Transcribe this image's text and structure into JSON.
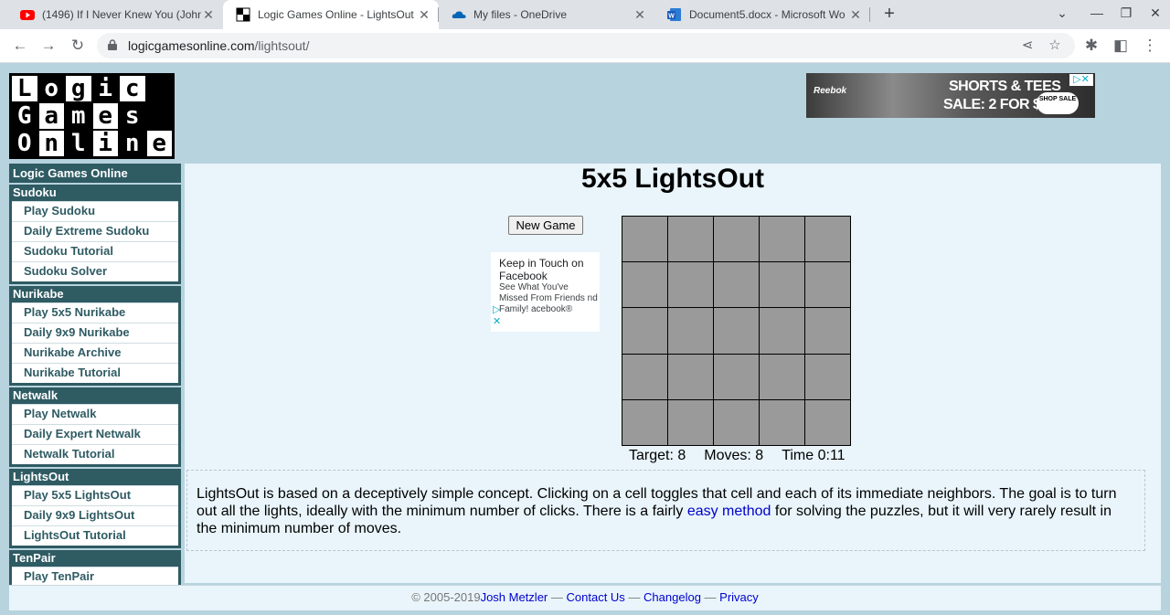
{
  "browser": {
    "tabs": [
      {
        "title": "(1496) If I Never Knew You (John",
        "favicon": "youtube-icon",
        "active": false
      },
      {
        "title": "Logic Games Online - LightsOut",
        "favicon": "logic-games-icon",
        "active": true
      },
      {
        "title": "My files - OneDrive",
        "favicon": "onedrive-icon",
        "active": false
      },
      {
        "title": "Document5.docx - Microsoft Wo",
        "favicon": "word-icon",
        "active": false
      }
    ],
    "url_host": "logicgamesonline.com",
    "url_path": "/lightsout/"
  },
  "logo": {
    "rows": [
      [
        "L",
        "o",
        "g",
        "i",
        "c",
        ""
      ],
      [
        "G",
        "a",
        "m",
        "e",
        "s",
        ""
      ],
      [
        "O",
        "n",
        "l",
        "i",
        "n",
        "e"
      ]
    ]
  },
  "ad_banner": {
    "brand": "Reebok",
    "line1": "SHORTS & TEES",
    "line2": "SALE: 2 FOR $50",
    "cta": "SHOP SALE"
  },
  "sidebar": {
    "home": "Logic Games Online",
    "groups": [
      {
        "title": "Sudoku",
        "items": [
          "Play Sudoku",
          "Daily Extreme Sudoku",
          "Sudoku Tutorial",
          "Sudoku Solver"
        ]
      },
      {
        "title": "Nurikabe",
        "items": [
          "Play 5x5 Nurikabe",
          "Daily 9x9 Nurikabe",
          "Nurikabe Archive",
          "Nurikabe Tutorial"
        ]
      },
      {
        "title": "Netwalk",
        "items": [
          "Play Netwalk",
          "Daily Expert Netwalk",
          "Netwalk Tutorial"
        ]
      },
      {
        "title": "LightsOut",
        "items": [
          "Play 5x5 LightsOut",
          "Daily 9x9 LightsOut",
          "LightsOut Tutorial"
        ]
      },
      {
        "title": "TenPair",
        "items": [
          "Play TenPair"
        ]
      }
    ]
  },
  "game": {
    "title": "5x5 LightsOut",
    "new_game_label": "New Game",
    "grid_size": 5,
    "cells_lit": [
      [
        false,
        false,
        false,
        false,
        false
      ],
      [
        false,
        false,
        false,
        false,
        false
      ],
      [
        false,
        false,
        false,
        false,
        false
      ],
      [
        false,
        false,
        false,
        false,
        false
      ],
      [
        false,
        false,
        false,
        false,
        false
      ]
    ],
    "target": "Target: 8",
    "moves": "Moves: 8",
    "time": "Time 0:11"
  },
  "ad_facebook": {
    "headline": "Keep in Touch on Facebook",
    "text": "See What You've Missed From Friends nd Family! acebook®"
  },
  "description": {
    "part1": "LightsOut is based on a deceptively simple concept. Clicking on a cell toggles that cell and each of its immediate neighbors. The goal is to turn out all the lights, ideally with the minimum number of clicks. There is a fairly ",
    "link": "easy method",
    "part2": " for solving the puzzles, but it will very rarely result in the minimum number of moves."
  },
  "footer": {
    "copyright": "© 2005-2019",
    "author": "Josh Metzler",
    "sep": " — ",
    "contact": "Contact Us",
    "changelog": "Changelog",
    "privacy": "Privacy"
  }
}
